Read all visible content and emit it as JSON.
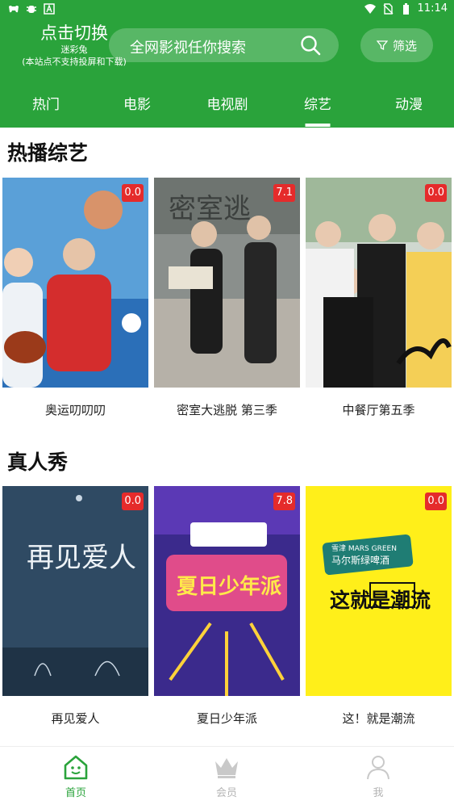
{
  "status_bar": {
    "time": "11:14"
  },
  "header": {
    "brand_title": "点击切换",
    "brand_name": "迷彩兔",
    "brand_note": "(本站点不支持投屏和下载)",
    "search_placeholder": "全网影视任你搜索",
    "filter_label": "筛选"
  },
  "tabs": [
    {
      "label": "热门",
      "active": false
    },
    {
      "label": "电影",
      "active": false
    },
    {
      "label": "电视剧",
      "active": false
    },
    {
      "label": "综艺",
      "active": true
    },
    {
      "label": "动漫",
      "active": false
    }
  ],
  "sections": [
    {
      "title": "热播综艺",
      "items": [
        {
          "title": "奥运叨叨叨",
          "score": "0.0"
        },
        {
          "title": "密室大逃脱 第三季",
          "score": "7.1"
        },
        {
          "title": "中餐厅第五季",
          "score": "0.0"
        }
      ]
    },
    {
      "title": "真人秀",
      "items": [
        {
          "title": "再见爱人",
          "score": "0.0"
        },
        {
          "title": "夏日少年派",
          "score": "7.8"
        },
        {
          "title": "这！就是潮流",
          "score": "0.0"
        }
      ]
    }
  ],
  "poster_text": {
    "secret_room_logo": "密室逃",
    "reunion_logo": "再见爱人",
    "summer_logo": "夏日少年派",
    "trend_brand": "马尔斯绿啤酒",
    "trend_brand_top": "雪津 MARS GREEN",
    "trend_logo": "这就是潮流"
  },
  "bottom_nav": [
    {
      "label": "首页",
      "active": true,
      "icon": "home-icon"
    },
    {
      "label": "会员",
      "active": false,
      "icon": "crown-icon"
    },
    {
      "label": "我",
      "active": false,
      "icon": "user-icon"
    }
  ],
  "colors": {
    "brand_green": "#2aa33b",
    "score_red": "#e52b2b",
    "inactive_gray": "#b5b5b5"
  }
}
